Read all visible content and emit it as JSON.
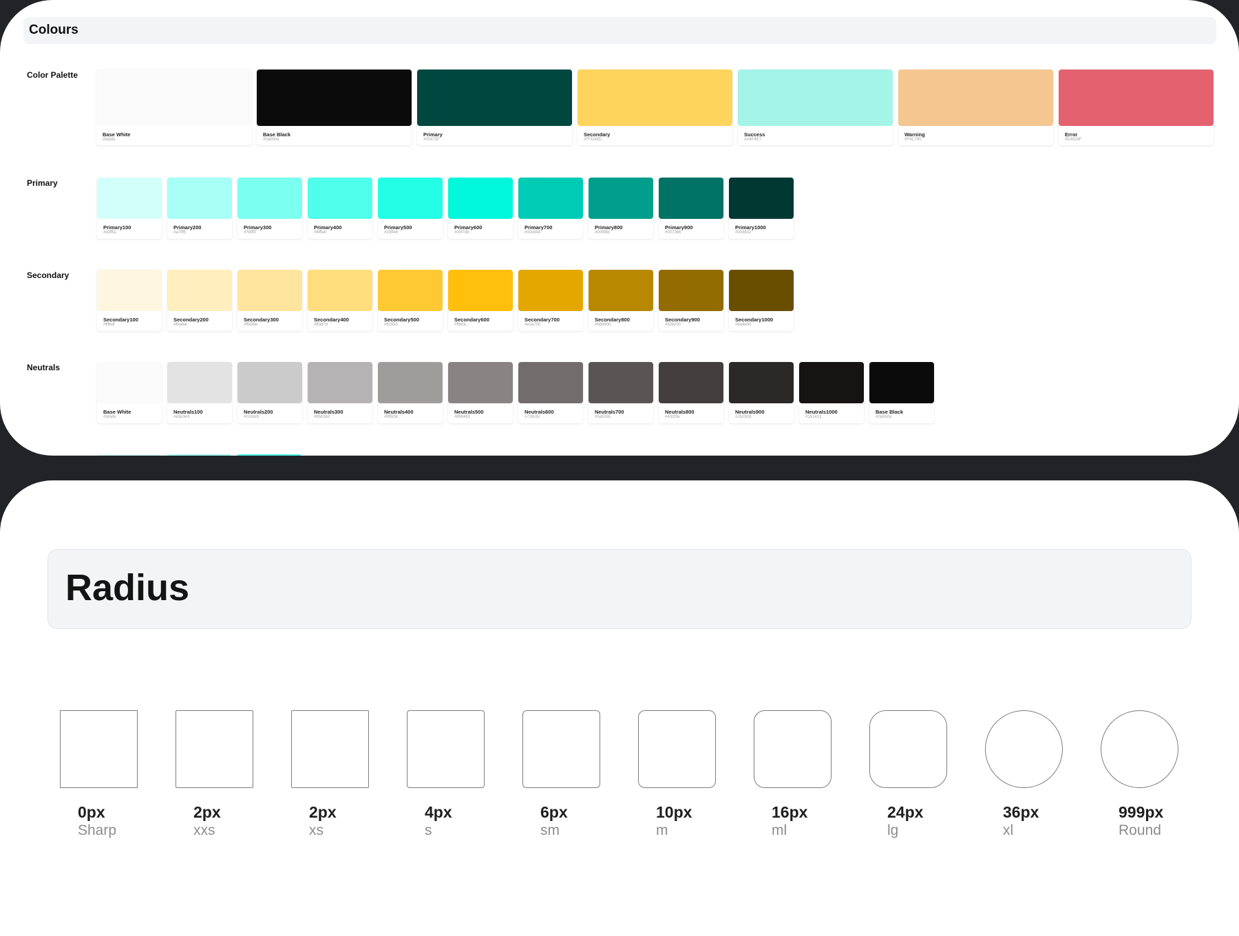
{
  "colours": {
    "title": "Colours",
    "groups": [
      {
        "label": "Color Palette",
        "swatches": [
          {
            "name": "Base White",
            "hex": "#fafafa",
            "color": "#fafafa"
          },
          {
            "name": "Base Black",
            "hex": "#0a0b0a",
            "color": "#0a0b0a"
          },
          {
            "name": "Primary",
            "hex": "#00473F",
            "color": "#00473f"
          },
          {
            "name": "Secondary",
            "hex": "#FFD45D",
            "color": "#ffd45d"
          },
          {
            "name": "Success",
            "hex": "#A4F4E7",
            "color": "#a4f4e7"
          },
          {
            "name": "Warning",
            "hex": "#F4C790",
            "color": "#f4c790"
          },
          {
            "name": "Error",
            "hex": "#E4626F",
            "color": "#e4626f"
          }
        ]
      },
      {
        "label": "Primary",
        "swatches": [
          {
            "name": "Primary100",
            "hex": "#d3fffa",
            "color": "#d3fffa"
          },
          {
            "name": "Primary200",
            "hex": "#a7fff5",
            "color": "#a7fff5"
          },
          {
            "name": "Primary300",
            "hex": "#7bfff0",
            "color": "#7bfff0"
          },
          {
            "name": "Primary400",
            "hex": "#4fffeb",
            "color": "#4fffeb"
          },
          {
            "name": "Primary500",
            "hex": "#23ffe6",
            "color": "#23ffe6"
          },
          {
            "name": "Primary600",
            "hex": "#00f7db",
            "color": "#00f7db"
          },
          {
            "name": "Primary700",
            "hex": "#00cbb4",
            "color": "#00cbb4"
          },
          {
            "name": "Primary800",
            "hex": "#009f8d",
            "color": "#009f8d"
          },
          {
            "name": "Primary900",
            "hex": "#007366",
            "color": "#007366"
          },
          {
            "name": "Primary1000",
            "hex": "#003832",
            "color": "#003832"
          }
        ]
      },
      {
        "label": "Secondary",
        "swatches": [
          {
            "name": "Secondary100",
            "hex": "#fff6df",
            "color": "#fff6df"
          },
          {
            "name": "Secondary200",
            "hex": "#ffeebe",
            "color": "#ffeebe"
          },
          {
            "name": "Secondary300",
            "hex": "#ffe59e",
            "color": "#ffe59e"
          },
          {
            "name": "Secondary400",
            "hex": "#ffdd7d",
            "color": "#ffdd7d"
          },
          {
            "name": "Secondary500",
            "hex": "#ffc933",
            "color": "#ffc933"
          },
          {
            "name": "Secondary600",
            "hex": "#ffbf0c",
            "color": "#ffbf0c"
          },
          {
            "name": "Secondary700",
            "hex": "#e3a700",
            "color": "#e3a700"
          },
          {
            "name": "Secondary800",
            "hex": "#b88900",
            "color": "#b88900"
          },
          {
            "name": "Secondary900",
            "hex": "#926c00",
            "color": "#926c00"
          },
          {
            "name": "Secondary1000",
            "hex": "#6a4e00",
            "color": "#6a4e00"
          }
        ]
      },
      {
        "label": "Neutrals",
        "swatches": [
          {
            "name": "Base White",
            "hex": "#fafafa",
            "color": "#fafafa"
          },
          {
            "name": "Neutrals100",
            "hex": "#e3e3e3",
            "color": "#e3e3e3"
          },
          {
            "name": "Neutrals200",
            "hex": "#cccbcb",
            "color": "#cccbcb"
          },
          {
            "name": "Neutrals300",
            "hex": "#b5b3b3",
            "color": "#b5b3b3"
          },
          {
            "name": "Neutrals400",
            "hex": "#9f9c9c",
            "color": "#9f9c9c"
          },
          {
            "name": "Neutrals500",
            "hex": "#898483",
            "color": "#898483"
          },
          {
            "name": "Neutrals600",
            "hex": "#726c6c",
            "color": "#726c6c"
          },
          {
            "name": "Neutrals700",
            "hex": "#5a5555",
            "color": "#5a5555"
          },
          {
            "name": "Neutrals800",
            "hex": "#433f3e",
            "color": "#433f3e"
          },
          {
            "name": "Neutrals900",
            "hex": "#2b2928",
            "color": "#2b2928"
          },
          {
            "name": "Neutrals1000",
            "hex": "#151413",
            "color": "#151413"
          },
          {
            "name": "Base Black",
            "hex": "#0a0b0a",
            "color": "#0a0b0a"
          }
        ]
      }
    ]
  },
  "radius": {
    "title": "Radius",
    "items": [
      {
        "value": "0px",
        "name": "Sharp"
      },
      {
        "value": "2px",
        "name": "xxs"
      },
      {
        "value": "2px",
        "name": "xs"
      },
      {
        "value": "4px",
        "name": "s"
      },
      {
        "value": "6px",
        "name": "sm"
      },
      {
        "value": "10px",
        "name": "m"
      },
      {
        "value": "16px",
        "name": "ml"
      },
      {
        "value": "24px",
        "name": "lg"
      },
      {
        "value": "36px",
        "name": "xl"
      },
      {
        "value": "999px",
        "name": "Round"
      }
    ]
  },
  "colors": {
    "background": "#212327",
    "card": "#ffffff",
    "header_bg": "#f3f4f5"
  }
}
